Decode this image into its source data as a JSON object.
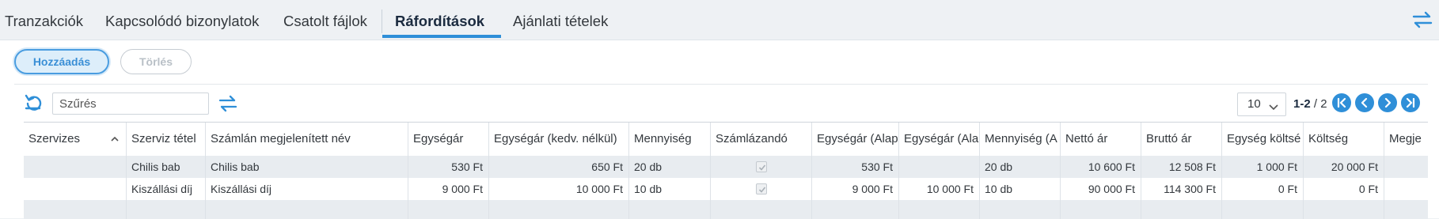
{
  "tabs": [
    {
      "label": "Tranzakciók"
    },
    {
      "label": "Kapcsolódó bizonylatok"
    },
    {
      "label": "Csatolt fájlok"
    },
    {
      "label": "Ráfordítások",
      "active": true
    },
    {
      "label": "Ajánlati tételek"
    }
  ],
  "toolbar": {
    "add_label": "Hozzáadás",
    "delete_label": "Törlés"
  },
  "filter": {
    "placeholder": "Szűrés",
    "value": "Szűrés"
  },
  "pagination": {
    "page_size": "10",
    "range": "1-2",
    "total": "2"
  },
  "table": {
    "columns": [
      "Szervizes",
      "Szerviz tétel",
      "Számlán megjelenített név",
      "Egységár",
      "Egységár (kedv. nélkül)",
      "Mennyiség",
      "Számlázandó",
      "Egységár (Alap",
      "Egységár (Ala",
      "Mennyiség (A",
      "Nettó ár",
      "Bruttó ár",
      "Egység költsé",
      "Költség",
      "Megje"
    ],
    "rows": [
      {
        "szervizes": "",
        "szerviz_tetel": "Chilis bab",
        "szamlan_nev": "Chilis bab",
        "egysegar": "530 Ft",
        "egysegar_kedv": "650 Ft",
        "mennyiseg": "20 db",
        "szamlazando": true,
        "egysegar_alap": "530 Ft",
        "egysegar_ala": "",
        "mennyiseg_a": "20 db",
        "netto": "10 600 Ft",
        "brutto": "12 508 Ft",
        "egyseg_koltseg": "1 000 Ft",
        "koltseg": "20 000 Ft",
        "megj": ""
      },
      {
        "szervizes": "",
        "szerviz_tetel": "Kiszállási díj",
        "szamlan_nev": "Kiszállási díj",
        "egysegar": "9 000 Ft",
        "egysegar_kedv": "10 000 Ft",
        "mennyiseg": "10 db",
        "szamlazando": true,
        "egysegar_alap": "9 000 Ft",
        "egysegar_ala": "10 000 Ft",
        "mennyiseg_a": "10 db",
        "netto": "90 000 Ft",
        "brutto": "114 300 Ft",
        "egyseg_koltseg": "0 Ft",
        "koltseg": "0 Ft",
        "megj": ""
      }
    ]
  },
  "colors": {
    "accent": "#2f8fd8",
    "alt_row": "#e8ecf0",
    "background": "#eef1f4"
  },
  "icons": {
    "refresh": "refresh-icon",
    "swap": "swap-arrows-icon",
    "first": "first-page-icon",
    "prev": "previous-page-icon",
    "next": "next-page-icon",
    "last": "last-page-icon",
    "sort": "sort-ascending-icon",
    "checkbox": "checkbox-checked-icon"
  }
}
